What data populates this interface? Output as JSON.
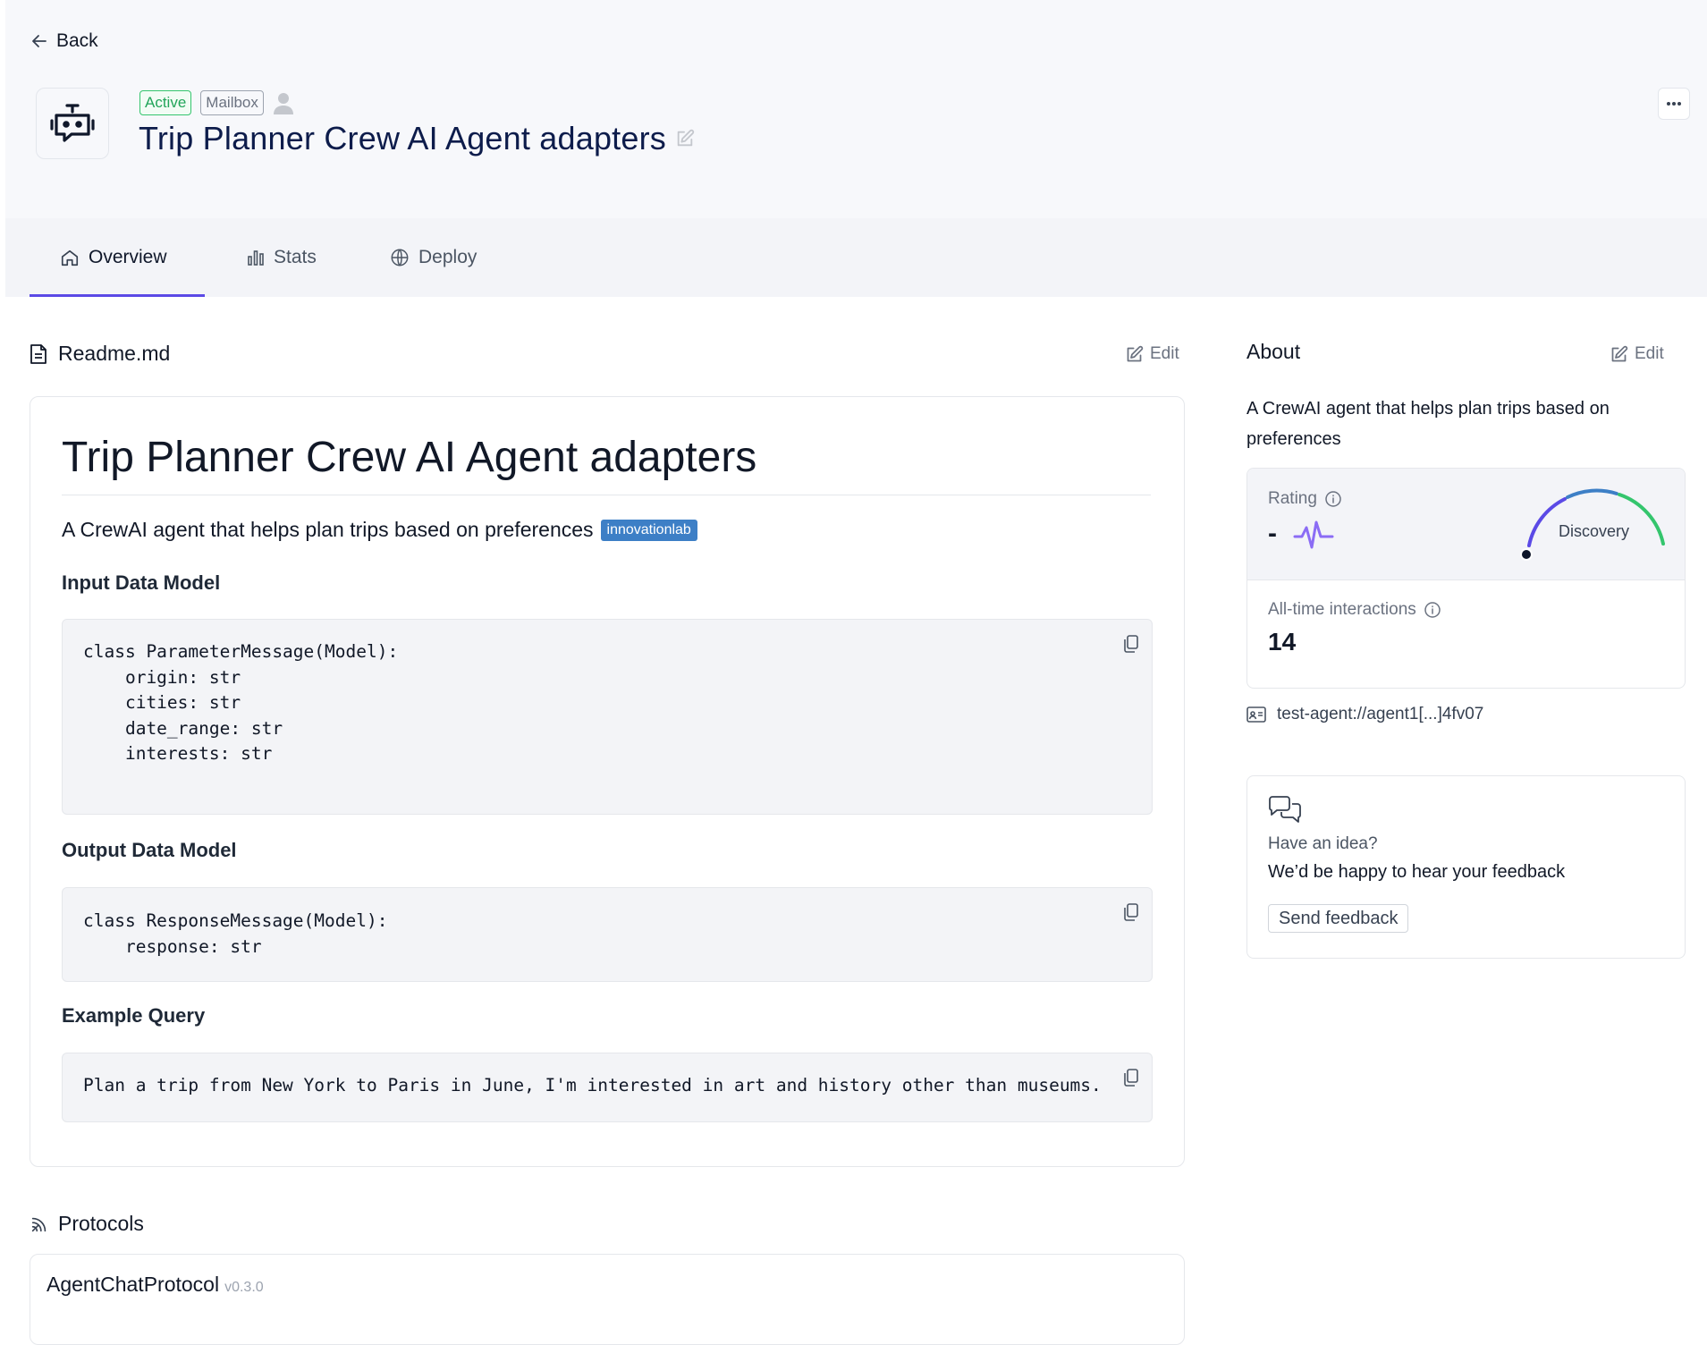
{
  "header": {
    "back_label": "Back",
    "status_badge": "Active",
    "mailbox_badge": "Mailbox",
    "agent_title": "Trip Planner Crew AI Agent adapters"
  },
  "tabs": [
    {
      "label": "Overview",
      "icon": "home-icon",
      "active": true
    },
    {
      "label": "Stats",
      "icon": "bar-chart-icon",
      "active": false
    },
    {
      "label": "Deploy",
      "icon": "globe-icon",
      "active": false
    }
  ],
  "readme": {
    "section_title": "Readme.md",
    "edit_label": "Edit",
    "heading": "Trip Planner Crew AI Agent adapters",
    "description": "A CrewAI agent that helps plan trips based on preferences",
    "tag": "innovationlab",
    "input_heading": "Input Data Model",
    "input_code": "class ParameterMessage(Model):\n    origin: str\n    cities: str\n    date_range: str\n    interests: str",
    "output_heading": "Output Data Model",
    "output_code": "class ResponseMessage(Model):\n    response: str",
    "example_heading": "Example Query",
    "example_code": "Plan a trip from New York to Paris in June, I'm interested in art and history other than museums."
  },
  "protocols": {
    "section_title": "Protocols",
    "items": [
      {
        "name": "AgentChatProtocol",
        "version": "v0.3.0"
      }
    ]
  },
  "about": {
    "title": "About",
    "edit_label": "Edit",
    "description": "A CrewAI agent that helps plan trips based on preferences",
    "rating_label": "Rating",
    "rating_value": "-",
    "gauge_label": "Discovery",
    "interactions_label": "All-time interactions",
    "interactions_value": "14",
    "address": "test-agent://agent1[...]4fv07"
  },
  "feedback": {
    "question": "Have an idea?",
    "text": "We’d be happy to hear your feedback",
    "button_label": "Send feedback"
  },
  "colors": {
    "accent": "#5b4ae6",
    "active_badge": "#22a55a",
    "tag_bg": "#3d7fc6",
    "header_bg": "#f7f8fb"
  }
}
